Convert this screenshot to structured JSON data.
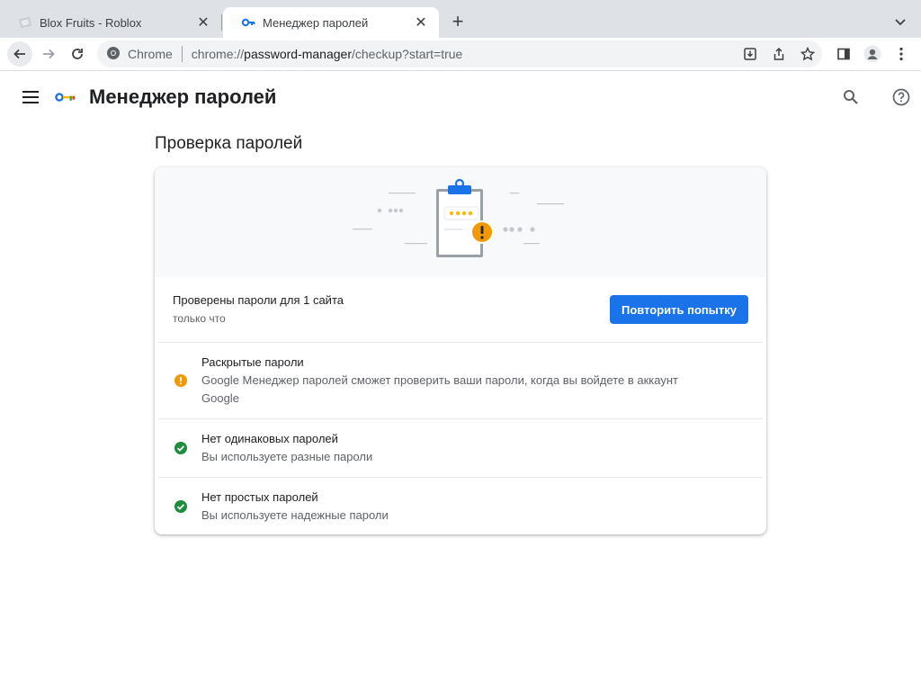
{
  "browser": {
    "tabs": [
      {
        "title": "Blox Fruits - Roblox",
        "favicon": "roblox-icon",
        "active": false
      },
      {
        "title": "Менеджер паролей",
        "favicon": "key-icon",
        "active": true
      }
    ],
    "omnibox": {
      "site_label": "Chrome",
      "url_scheme": "chrome://",
      "url_host": "password-manager",
      "url_path": "/checkup?start=true"
    },
    "colors": {
      "tabstrip": "#dee1e6",
      "omnibox": "#f1f3f4"
    }
  },
  "app": {
    "title": "Менеджер паролей",
    "section_title": "Проверка паролей"
  },
  "checkup": {
    "status_title": "Проверены пароли для 1 сайта",
    "status_time": "только что",
    "retry_button": "Повторить попытку",
    "results": [
      {
        "title": "Раскрытые пароли",
        "description": "Google Менеджер паролей сможет проверить ваши пароли, когда вы войдете в аккаунт Google",
        "status": "warning",
        "icon": "warning-icon"
      },
      {
        "title": "Нет одинаковых паролей",
        "description": "Вы используете разные пароли",
        "status": "ok",
        "icon": "check-circle-icon"
      },
      {
        "title": "Нет простых паролей",
        "description": "Вы используете надежные пароли",
        "status": "ok",
        "icon": "check-circle-icon"
      }
    ]
  },
  "theme": {
    "accent": "#1a73e8",
    "warning": "#f29900",
    "success": "#1e8e3e"
  }
}
